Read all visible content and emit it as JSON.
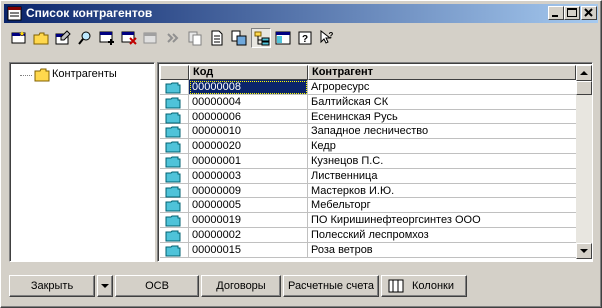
{
  "window": {
    "title": "Список контрагентов"
  },
  "tree": {
    "root_label": "Контрагенты"
  },
  "table": {
    "headers": {
      "code": "Код",
      "name": "Контрагент"
    },
    "rows": [
      {
        "code": "00000008",
        "name": "Агроресурс",
        "selected": true
      },
      {
        "code": "00000004",
        "name": "Балтийская СК"
      },
      {
        "code": "00000006",
        "name": "Есенинская Русь"
      },
      {
        "code": "00000010",
        "name": "Западное лесничество"
      },
      {
        "code": "00000020",
        "name": "Кедр"
      },
      {
        "code": "00000001",
        "name": "Кузнецов П.С."
      },
      {
        "code": "00000003",
        "name": "Лиственница"
      },
      {
        "code": "00000009",
        "name": "Мастерков И.Ю."
      },
      {
        "code": "00000005",
        "name": "Мебельторг"
      },
      {
        "code": "00000019",
        "name": "ПО Киришинефтеоргсинтез ООО"
      },
      {
        "code": "00000002",
        "name": "Полесский леспромхоз"
      },
      {
        "code": "00000015",
        "name": "Роза ветров"
      }
    ]
  },
  "buttons": {
    "close": "Закрыть",
    "osv": "ОСВ",
    "contracts": "Договоры",
    "accounts": "Расчетные счета",
    "columns": "Колонки"
  },
  "colors": {
    "title_start": "#0a246a",
    "title_end": "#a6caf0",
    "face": "#d4d0c8",
    "selection": "#0a246a",
    "folder": "#4fc3d9"
  }
}
